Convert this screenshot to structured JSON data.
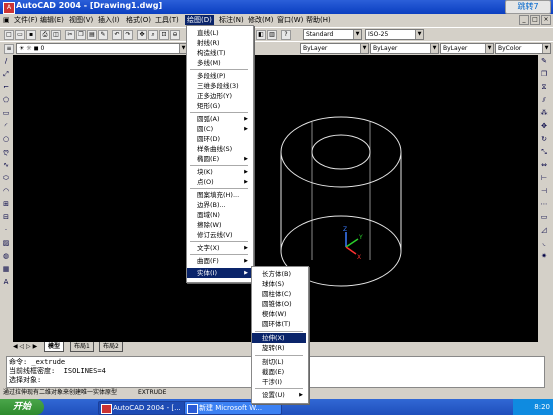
{
  "window": {
    "title": "AutoCAD 2004 - [Drawing1.dwg]",
    "jump_badge": "跳转7"
  },
  "menubar": {
    "items": [
      "文件(F)",
      "编辑(E)",
      "视图(V)",
      "插入(I)",
      "格式(O)",
      "工具(T)",
      "绘图(D)",
      "标注(N)",
      "修改(M)",
      "窗口(W)",
      "帮助(H)"
    ],
    "active": "绘图(D)"
  },
  "toolbar": {
    "text_style": "Standard",
    "dim_style": "ISO-25",
    "layer_color": "ByLayer",
    "linetype": "ByLayer",
    "lineweight": "ByLayer",
    "plot_color": "ByColor",
    "layer_name": "0"
  },
  "draw_menu": {
    "items": [
      "直线(L)",
      "射线(R)",
      "构造线(T)",
      "多线(M)",
      "多段线(P)",
      "三维多段线(3)",
      "正多边形(Y)",
      "矩形(G)",
      "圆弧(A)",
      "圆(C)",
      "圆环(D)",
      "样条曲线(S)",
      "椭圆(E)",
      "块(K)",
      "点(O)",
      "图案填充(H)...",
      "边界(B)...",
      "面域(N)",
      "擦除(W)",
      "修订云线(V)",
      "文字(X)",
      "曲面(F)",
      "实体(I)"
    ],
    "highlighted": "实体(I)"
  },
  "solids_menu": {
    "items": [
      "长方体(B)",
      "球体(S)",
      "圆柱体(C)",
      "圆锥体(O)",
      "楔体(W)",
      "圆环体(T)",
      "拉伸(X)",
      "旋转(R)",
      "剖切(L)",
      "截面(E)",
      "干涉(I)",
      "设置(U)"
    ],
    "highlighted": "拉伸(X)"
  },
  "layout_tabs": [
    "模型",
    "布局1",
    "布局2"
  ],
  "command_lines": [
    "命令: _extrude",
    "当前线框密度:  ISOLINES=4",
    "选择对象:"
  ],
  "status": {
    "hint": "通过拉伸现有二维对象来创建唯一实体原型",
    "command": "EXTRUDE"
  },
  "taskbar": {
    "start": "开始",
    "tasks": [
      "AutoCAD 2004 - [...",
      "新建 Microsoft W..."
    ],
    "clock": "8:20"
  },
  "colors": {
    "canvas": "#000000",
    "menu_highlight": "#0a246a",
    "title_bar": "#0a3ec0",
    "taskbar": "#3168d5",
    "start": "#3c9a3c"
  }
}
